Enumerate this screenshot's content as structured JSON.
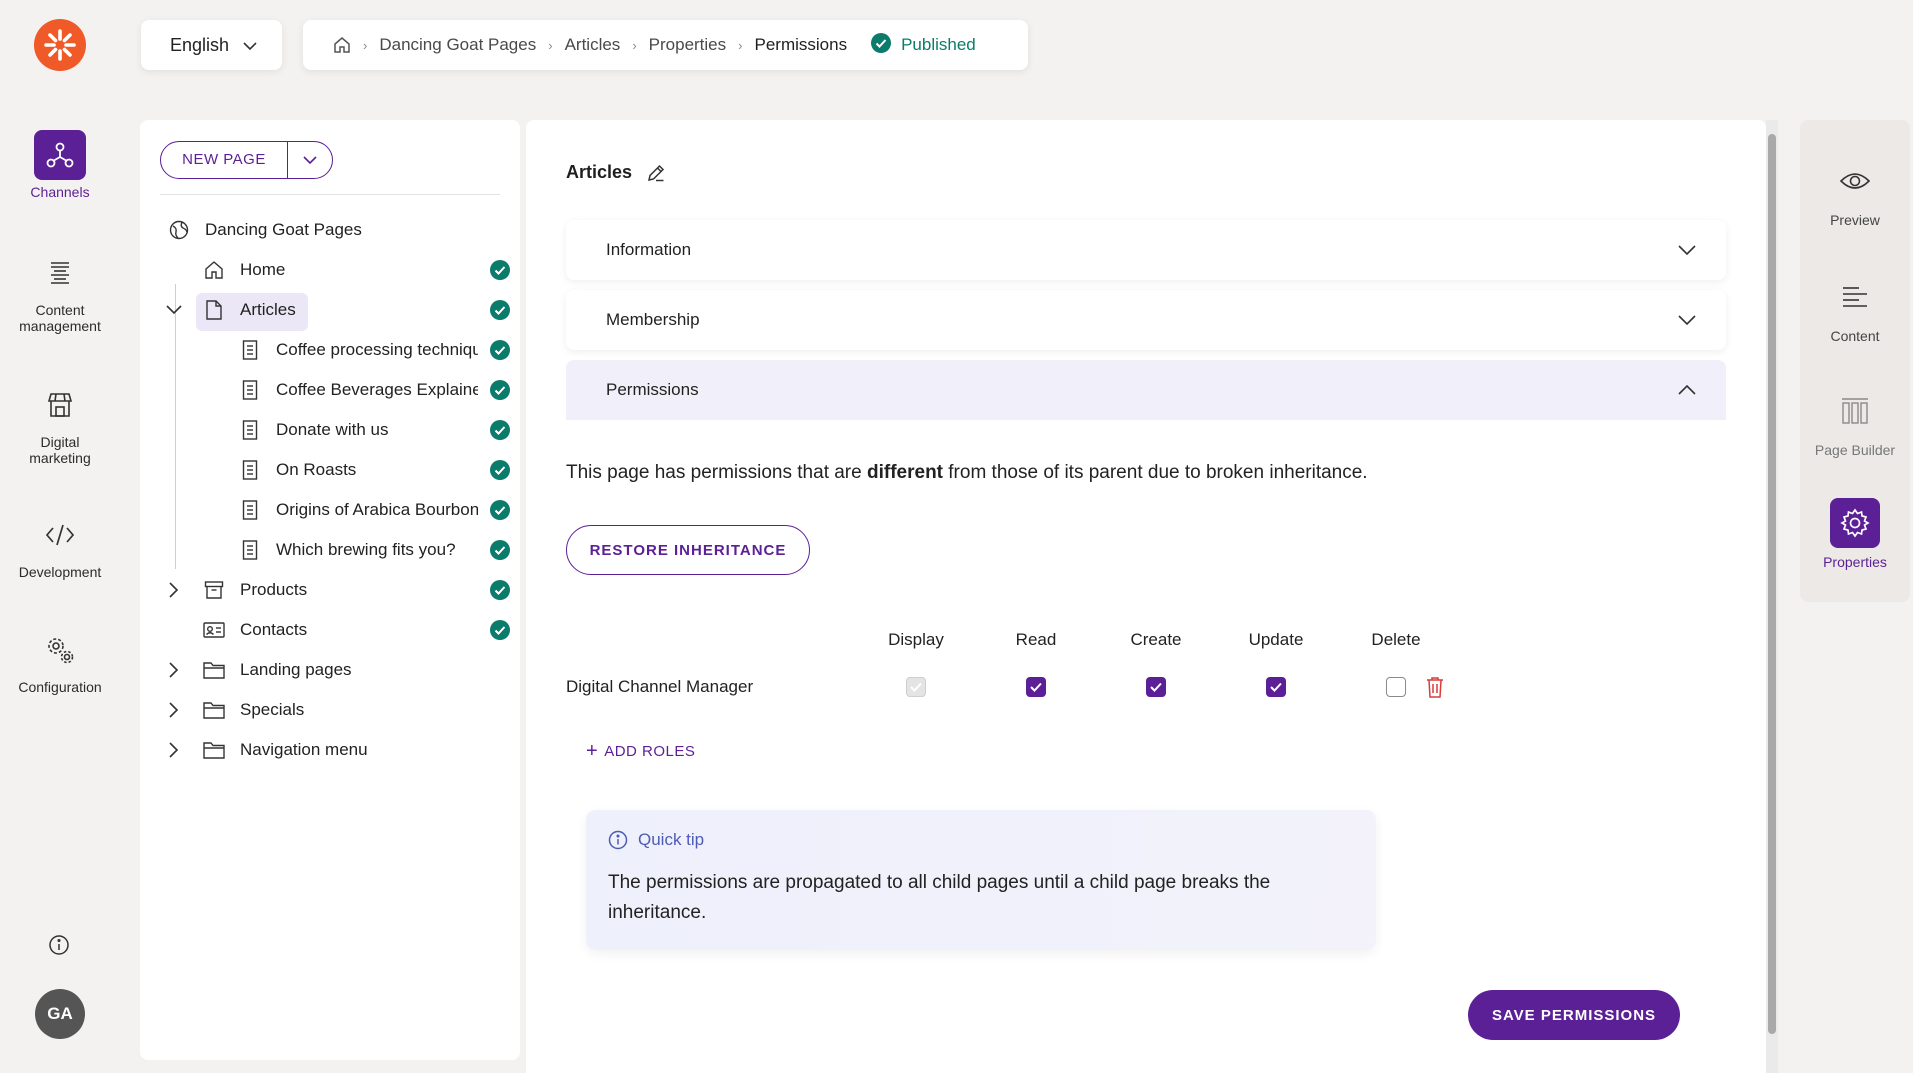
{
  "language": {
    "selected": "English"
  },
  "breadcrumb": {
    "items": [
      "Dancing Goat Pages",
      "Articles",
      "Properties"
    ],
    "current": "Permissions",
    "status": "Published"
  },
  "left_nav": {
    "items": [
      {
        "label_line1": "Channels",
        "label_line2": "",
        "icon": "channels-icon",
        "active": true
      },
      {
        "label_line1": "Content",
        "label_line2": "management",
        "icon": "content-management-icon"
      },
      {
        "label_line1": "Digital",
        "label_line2": "marketing",
        "icon": "digital-marketing-icon"
      },
      {
        "label_line1": "Development",
        "label_line2": "",
        "icon": "code-icon"
      },
      {
        "label_line1": "Configuration",
        "label_line2": "",
        "icon": "gear-icon"
      }
    ],
    "avatar_initials": "GA"
  },
  "tree": {
    "new_page_label": "NEW PAGE",
    "root": "Dancing Goat Pages",
    "items": [
      {
        "label": "Home"
      },
      {
        "label": "Articles"
      },
      {
        "label": "Coffee processing techniques"
      },
      {
        "label": "Coffee Beverages Explained"
      },
      {
        "label": "Donate with us"
      },
      {
        "label": "On Roasts"
      },
      {
        "label": "Origins of Arabica Bourbon"
      },
      {
        "label": "Which brewing fits you?"
      },
      {
        "label": "Products"
      },
      {
        "label": "Contacts"
      },
      {
        "label": "Landing pages"
      },
      {
        "label": "Specials"
      },
      {
        "label": "Navigation menu"
      }
    ]
  },
  "main": {
    "title": "Articles",
    "sections": {
      "information": "Information",
      "membership": "Membership",
      "permissions": "Permissions"
    },
    "permissions": {
      "message_pre": "This page has permissions that are ",
      "message_bold": "different",
      "message_post": " from those of its parent due to broken inheritance.",
      "restore_label": "RESTORE INHERITANCE",
      "columns": [
        "Display",
        "Read",
        "Create",
        "Update",
        "Delete"
      ],
      "role": "Digital Channel Manager",
      "role_values": {
        "display": "disabled",
        "read": true,
        "create": true,
        "update": true,
        "delete": false
      },
      "add_roles_label": "ADD ROLES",
      "tip_title": "Quick tip",
      "tip_body": "The permissions are propagated to all child pages until a child page breaks the inheritance.",
      "save_label": "SAVE PERMISSIONS"
    }
  },
  "right_nav": {
    "items": [
      {
        "label": "Preview",
        "icon": "eye-icon"
      },
      {
        "label": "Content",
        "icon": "content-lines-icon"
      },
      {
        "label": "Page Builder",
        "icon": "page-builder-icon"
      },
      {
        "label": "Properties",
        "icon": "gear-icon",
        "active": true
      }
    ]
  },
  "colors": {
    "accent": "#5b1f96",
    "brand": "#f05a28",
    "published": "#0b7b6b",
    "danger": "#d93b3b"
  }
}
